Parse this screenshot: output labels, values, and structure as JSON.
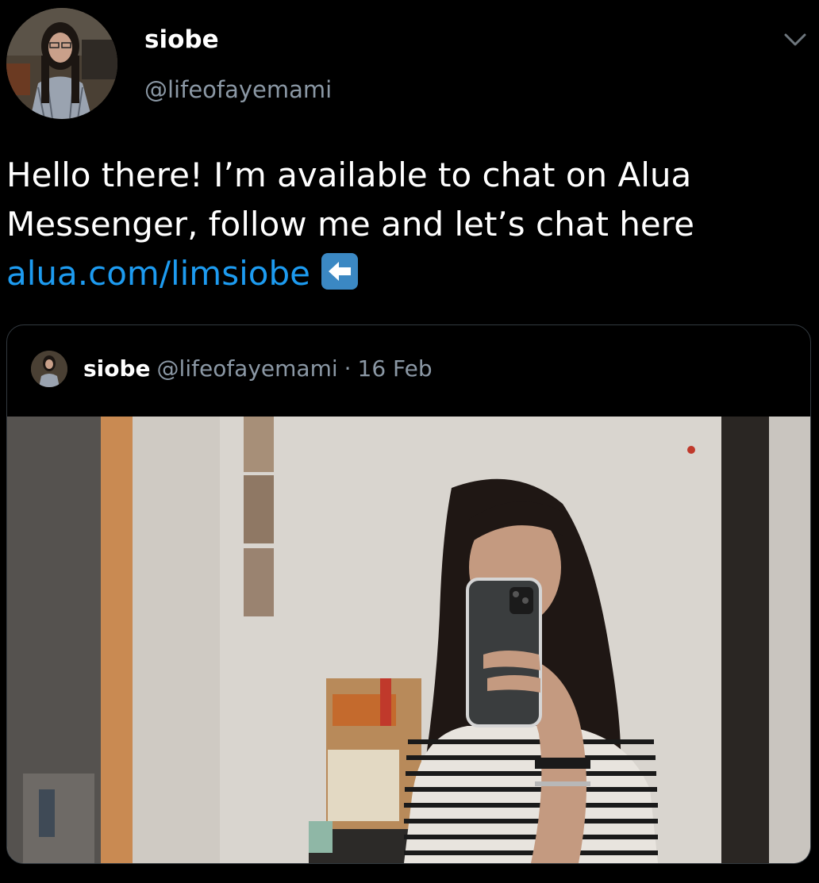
{
  "tweet": {
    "author_name": "siobe",
    "author_handle": "@lifeofayemami",
    "text_line1": "Hello there! I’m available to chat on Alua",
    "text_line2": "Messenger, follow me and let’s chat here",
    "link_text": "alua.com/limsiobe",
    "emoji_icon": "left-arrow-emoji-icon"
  },
  "quoted_tweet": {
    "author_name": "siobe",
    "author_handle": "@lifeofayemami",
    "separator": "·",
    "date": "16 Feb"
  },
  "colors": {
    "background": "#000000",
    "link": "#1d9bf0",
    "secondary_text": "#8b98a5",
    "border": "#333a40"
  }
}
